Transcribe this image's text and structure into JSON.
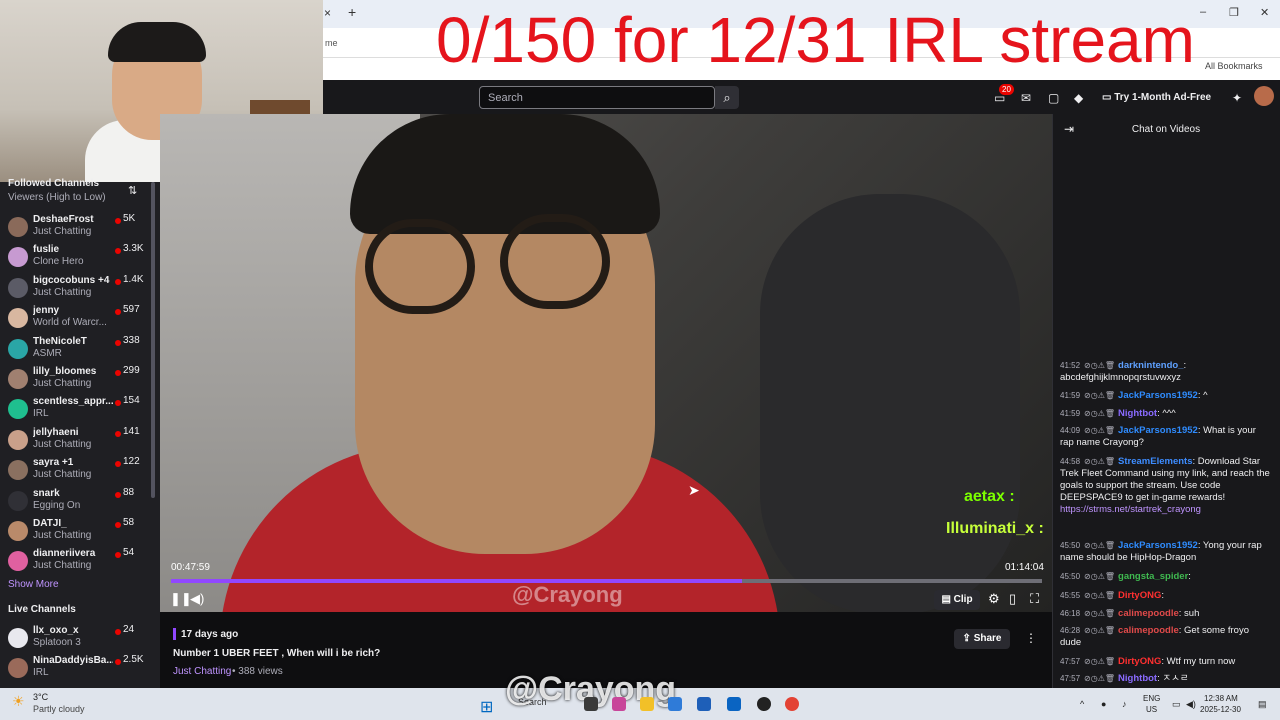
{
  "overlay_text": "0/150 for 12/31 IRL stream",
  "browser": {
    "tab_close": "×",
    "tab_new": "+",
    "address_fragment": "me",
    "bookmarks_label": "All Bookmarks",
    "window_minimize": "–",
    "window_restore": "❐",
    "window_close": "✕"
  },
  "topnav": {
    "search_placeholder": "Search",
    "notifications_count": "20",
    "ad_free_label": "Try 1-Month Ad-Free"
  },
  "sidebar": {
    "followed_heading": "Followed Channels",
    "sort_label": "Viewers (High to Low)",
    "channels": [
      {
        "name": "DeshaeFrost",
        "game": "Just Chatting",
        "viewers": "5K",
        "color": "#8a6a5a"
      },
      {
        "name": "fuslie",
        "game": "Clone Hero",
        "viewers": "3.3K",
        "color": "#c79ad1"
      },
      {
        "name": "bigcocobuns +4",
        "game": "Just Chatting",
        "viewers": "1.4K",
        "color": "#5b5b66"
      },
      {
        "name": "jenny",
        "game": "World of Warcr...",
        "viewers": "597",
        "color": "#d8b7a0"
      },
      {
        "name": "TheNicoleT",
        "game": "ASMR",
        "viewers": "338",
        "color": "#2aa6a6"
      },
      {
        "name": "lilly_bloomes",
        "game": "Just Chatting",
        "viewers": "299",
        "color": "#a08070"
      },
      {
        "name": "scentless_appr...",
        "game": "IRL",
        "viewers": "154",
        "color": "#1fbf8f"
      },
      {
        "name": "jellyhaeni",
        "game": "Just Chatting",
        "viewers": "141",
        "color": "#c9a08a"
      },
      {
        "name": "sayra +1",
        "game": "Just Chatting",
        "viewers": "122",
        "color": "#8a7060"
      },
      {
        "name": "snark",
        "game": "Egging On",
        "viewers": "88",
        "color": "#303036"
      },
      {
        "name": "DATJI_",
        "game": "Just Chatting",
        "viewers": "58",
        "color": "#b98a6a"
      },
      {
        "name": "dianneriivera",
        "game": "Just Chatting",
        "viewers": "54",
        "color": "#e060a0"
      }
    ],
    "show_more": "Show More",
    "live_heading": "Live Channels",
    "live_channels": [
      {
        "name": "llx_oxo_x",
        "game": "Splatoon 3",
        "viewers": "24",
        "color": "#e8e8ee"
      },
      {
        "name": "NinaDaddyisBa...",
        "game": "IRL",
        "viewers": "2.5K",
        "color": "#9a6a5a"
      }
    ]
  },
  "video": {
    "current_time": "00:47:59",
    "total_time": "01:14:04",
    "progress": 0.655,
    "buffered": 0.655,
    "watermark": "@Crayong",
    "overlay_chat_1": "aetax :",
    "overlay_chat_2": "Illuminati_x :",
    "clip_label": "Clip"
  },
  "info": {
    "date": "17 days ago",
    "title": "Number 1 UBER FEET , When will i be rich?",
    "category": "Just Chatting",
    "views": "• 388 views",
    "share_label": "Share"
  },
  "chat": {
    "title": "Chat on Videos",
    "messages": [
      {
        "time": "41:52",
        "user": "darknintendo_",
        "color": "#5ea0ff",
        "text": "abcdefghijklmnopqrstuvwxyz"
      },
      {
        "time": "41:59",
        "user": "JackParsons1952",
        "color": "#2f8cff",
        "text": "^"
      },
      {
        "time": "41:59",
        "user": "Nightbot",
        "color": "#8a6bff",
        "text": "^^^"
      },
      {
        "time": "44:09",
        "user": "JackParsons1952",
        "color": "#2f8cff",
        "text": "What is your rap name Crayong?"
      },
      {
        "time": "44:58",
        "user": "StreamElements",
        "color": "#3d8cff",
        "text": "Download Star Trek Fleet Command using my link, and reach the goals to support the stream. Use code DEEPSPACE9 to get in-game rewards!",
        "link": "https://strms.net/startrek_crayong"
      },
      {
        "time": "45:50",
        "user": "JackParsons1952",
        "color": "#2f8cff",
        "text": "Yong your rap name should be HipHop-Dragon"
      },
      {
        "time": "45:50",
        "user": "gangsta_spider",
        "color": "#3fb950",
        "text": ""
      },
      {
        "time": "45:55",
        "user": "DirtyONG",
        "color": "#ff3030",
        "text": ""
      },
      {
        "time": "46:18",
        "user": "calimepoodle",
        "color": "#e04a4a",
        "text": "suh"
      },
      {
        "time": "46:28",
        "user": "calimepoodle",
        "color": "#e04a4a",
        "text": "Get some froyo dude"
      },
      {
        "time": "47:57",
        "user": "DirtyONG",
        "color": "#ff3030",
        "text": "Wtf my turn now"
      },
      {
        "time": "47:57",
        "user": "Nightbot",
        "color": "#8a6bff",
        "text": "ㅈㅅㄹ"
      }
    ]
  },
  "taskbar": {
    "temp": "3°C",
    "weather": "Partly cloudy",
    "search_label": "Search",
    "watermark": "@Crayong",
    "lang": "ENG",
    "region": "US",
    "time": "12:38 AM",
    "date": "2025-12-30"
  }
}
